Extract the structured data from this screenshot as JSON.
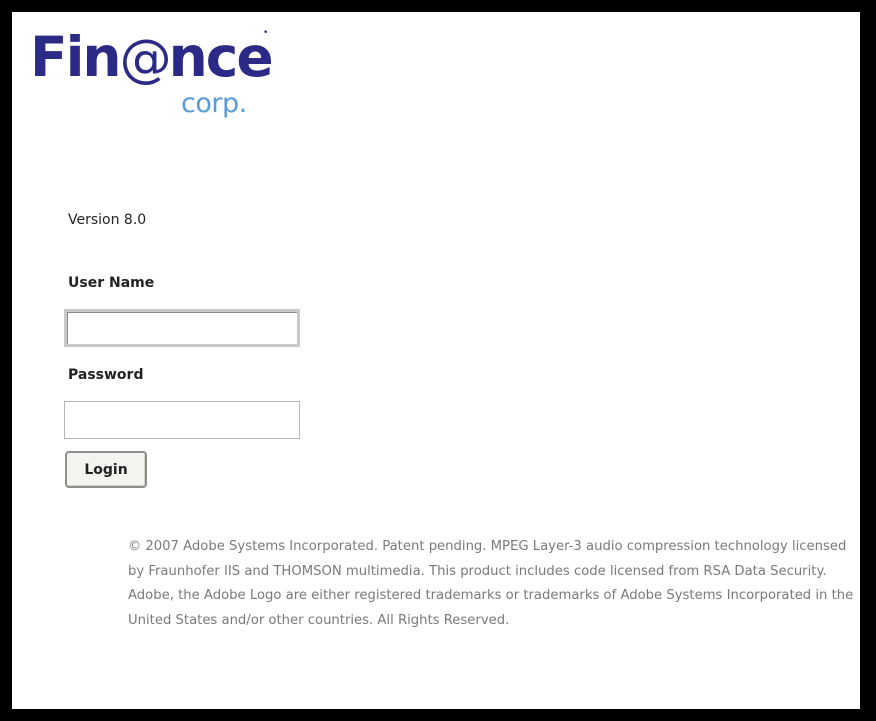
{
  "logo": {
    "fin": "Fin",
    "at": "@",
    "nce": "nce",
    "dot": "•",
    "sub": "corp."
  },
  "version": "Version 8.0",
  "form": {
    "username_label": "User Name",
    "username_value": "",
    "password_label": "Password",
    "password_value": "",
    "login_label": "Login"
  },
  "legal": "© 2007 Adobe Systems Incorporated. Patent pending. MPEG Layer-3 audio compression technology licensed by Fraunhofer IIS and THOMSON multimedia. This product includes code licensed from RSA Data Security. Adobe, the Adobe Logo are either registered trademarks or trademarks of Adobe Systems Incorporated in the United States and/or other countries. All Rights Reserved.",
  "colors": {
    "logo_primary": "#2b2b87",
    "logo_secondary": "#5a9ad6",
    "frame": "#000000",
    "legal_text": "#7a7a7a"
  }
}
